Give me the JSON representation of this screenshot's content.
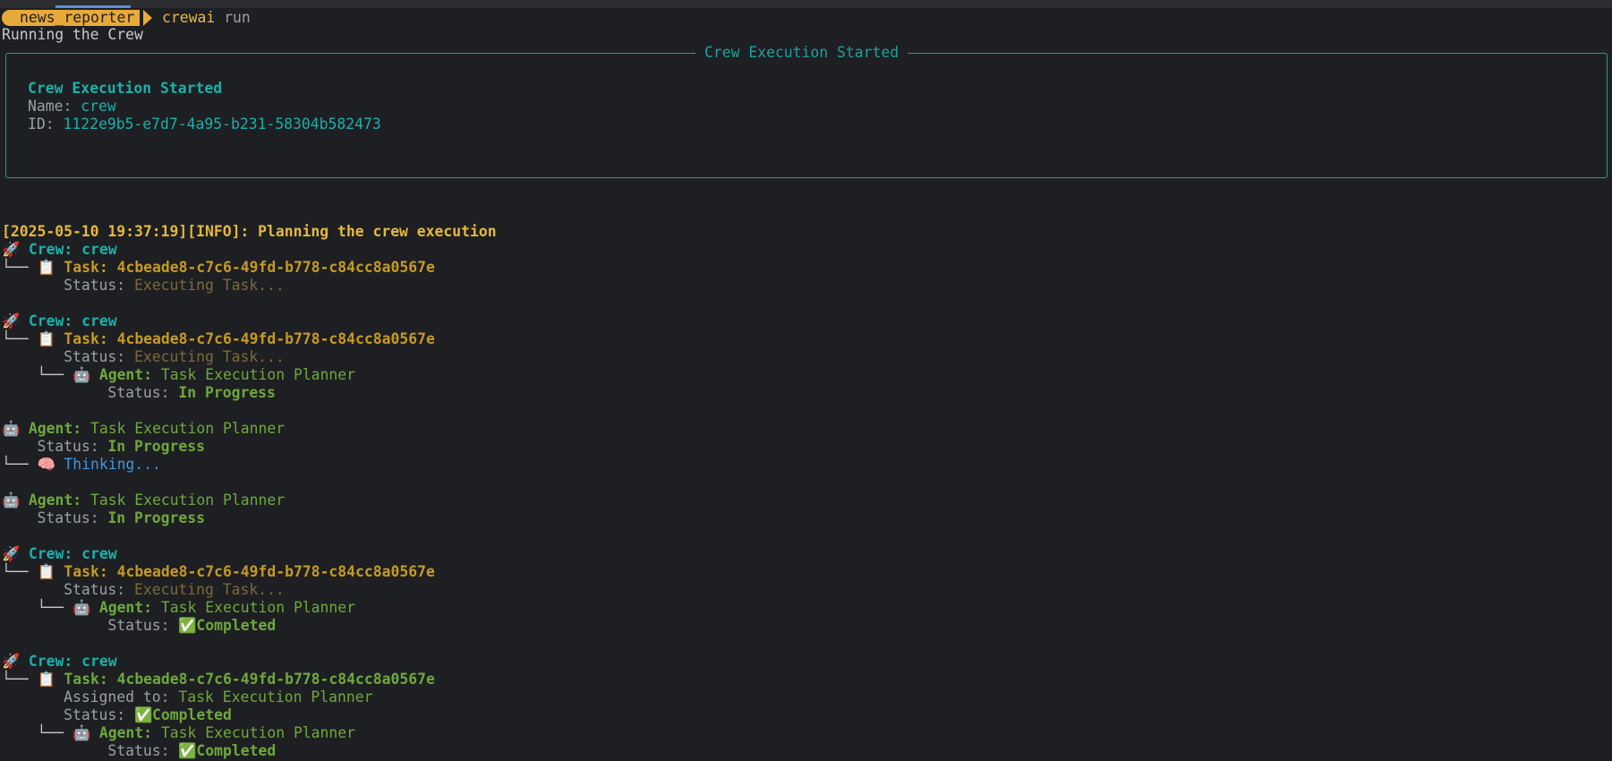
{
  "prompt": {
    "path": "news_reporter",
    "command": "crewai",
    "argument": "run"
  },
  "running_msg": "Running the Crew",
  "panel": {
    "title": "Crew Execution Started",
    "heading": "Crew Execution Started",
    "name_label": "Name:",
    "name_value": "crew",
    "id_label": "ID:",
    "id_value": "1122e9b5-e7d7-4a95-b231-58304b582473"
  },
  "info_line": "[2025-05-10 19:37:19][INFO]: Planning the crew execution",
  "labels": {
    "crew": "Crew:",
    "task": "Task:",
    "status": "Status:",
    "agent": "Agent:",
    "assigned": "Assigned to:"
  },
  "values": {
    "crew_name": "crew",
    "task_id": "4cbeade8-c7c6-49fd-b778-c84cc8a0567e",
    "executing": "Executing Task...",
    "agent_name": "Task Execution Planner",
    "in_progress": "In Progress",
    "thinking": "Thinking...",
    "completed": "Completed"
  },
  "icons": {
    "crew": "rocket-icon",
    "task": "clipboard-icon",
    "agent": "robot-icon",
    "thinking": "brain-icon",
    "completed": "check-icon"
  },
  "colors": {
    "background": "#1e1f22",
    "accent_teal": "#1ab0ac",
    "info_yellow": "#e5b83c",
    "task_gold": "#c69a22",
    "agent_green": "#6ea83c",
    "thinking_blue": "#3f95e0",
    "prompt_orange": "#e8a93b"
  }
}
